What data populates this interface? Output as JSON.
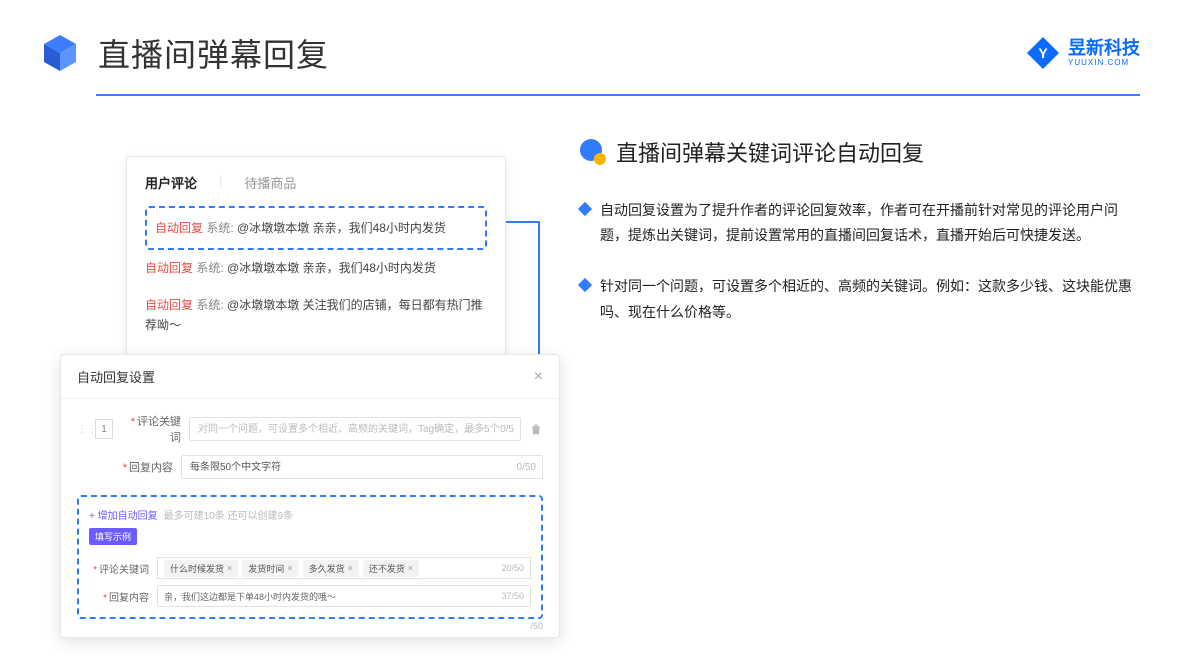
{
  "header": {
    "title": "直播间弹幕回复",
    "brand_name": "昱新科技",
    "brand_sub": "YUUXIN.COM"
  },
  "comments_card": {
    "tab_active": "用户评论",
    "tab_inactive": "待播商品",
    "rows": [
      {
        "tag": "自动回复",
        "sys": "系统:",
        "text": "@冰墩墩本墩 亲亲，我们48小时内发货"
      },
      {
        "tag": "自动回复",
        "sys": "系统:",
        "text": "@冰墩墩本墩 亲亲，我们48小时内发货"
      },
      {
        "tag": "自动回复",
        "sys": "系统:",
        "text": "@冰墩墩本墩 关注我们的店铺，每日都有热门推荐呦～"
      }
    ]
  },
  "settings_card": {
    "title": "自动回复设置",
    "idx": "1",
    "label_keyword": "评论关键词",
    "ph_keyword": "对同一个问题，可设置多个相近、高频的关键词，Tag确定，最多5个",
    "count_keyword": "0/5",
    "label_content": "回复内容",
    "ph_content": "每条限50个中文字符",
    "count_content": "0/50",
    "add_link": "+ 增加自动回复",
    "add_hint": "最多可建10条 还可以创建9条",
    "badge": "填写示例",
    "ex_label_kw": "评论关键词",
    "ex_tags": [
      "什么时候发货",
      "发货时间",
      "多久发货",
      "还不发货"
    ],
    "ex_kw_count": "20/50",
    "ex_label_ct": "回复内容",
    "ex_ct_text": "亲，我们这边都是下单48小时内发货的哦～",
    "ex_ct_count": "37/50",
    "extra_count": "/50"
  },
  "right": {
    "section_title": "直播间弹幕关键词评论自动回复",
    "bullets": [
      "自动回复设置为了提升作者的评论回复效率，作者可在开播前针对常见的评论用户问题，提炼出关键词，提前设置常用的直播间回复话术，直播开始后可快捷发送。",
      "针对同一个问题，可设置多个相近的、高频的关键词。例如：这款多少钱、这块能优惠吗、现在什么价格等。"
    ]
  }
}
